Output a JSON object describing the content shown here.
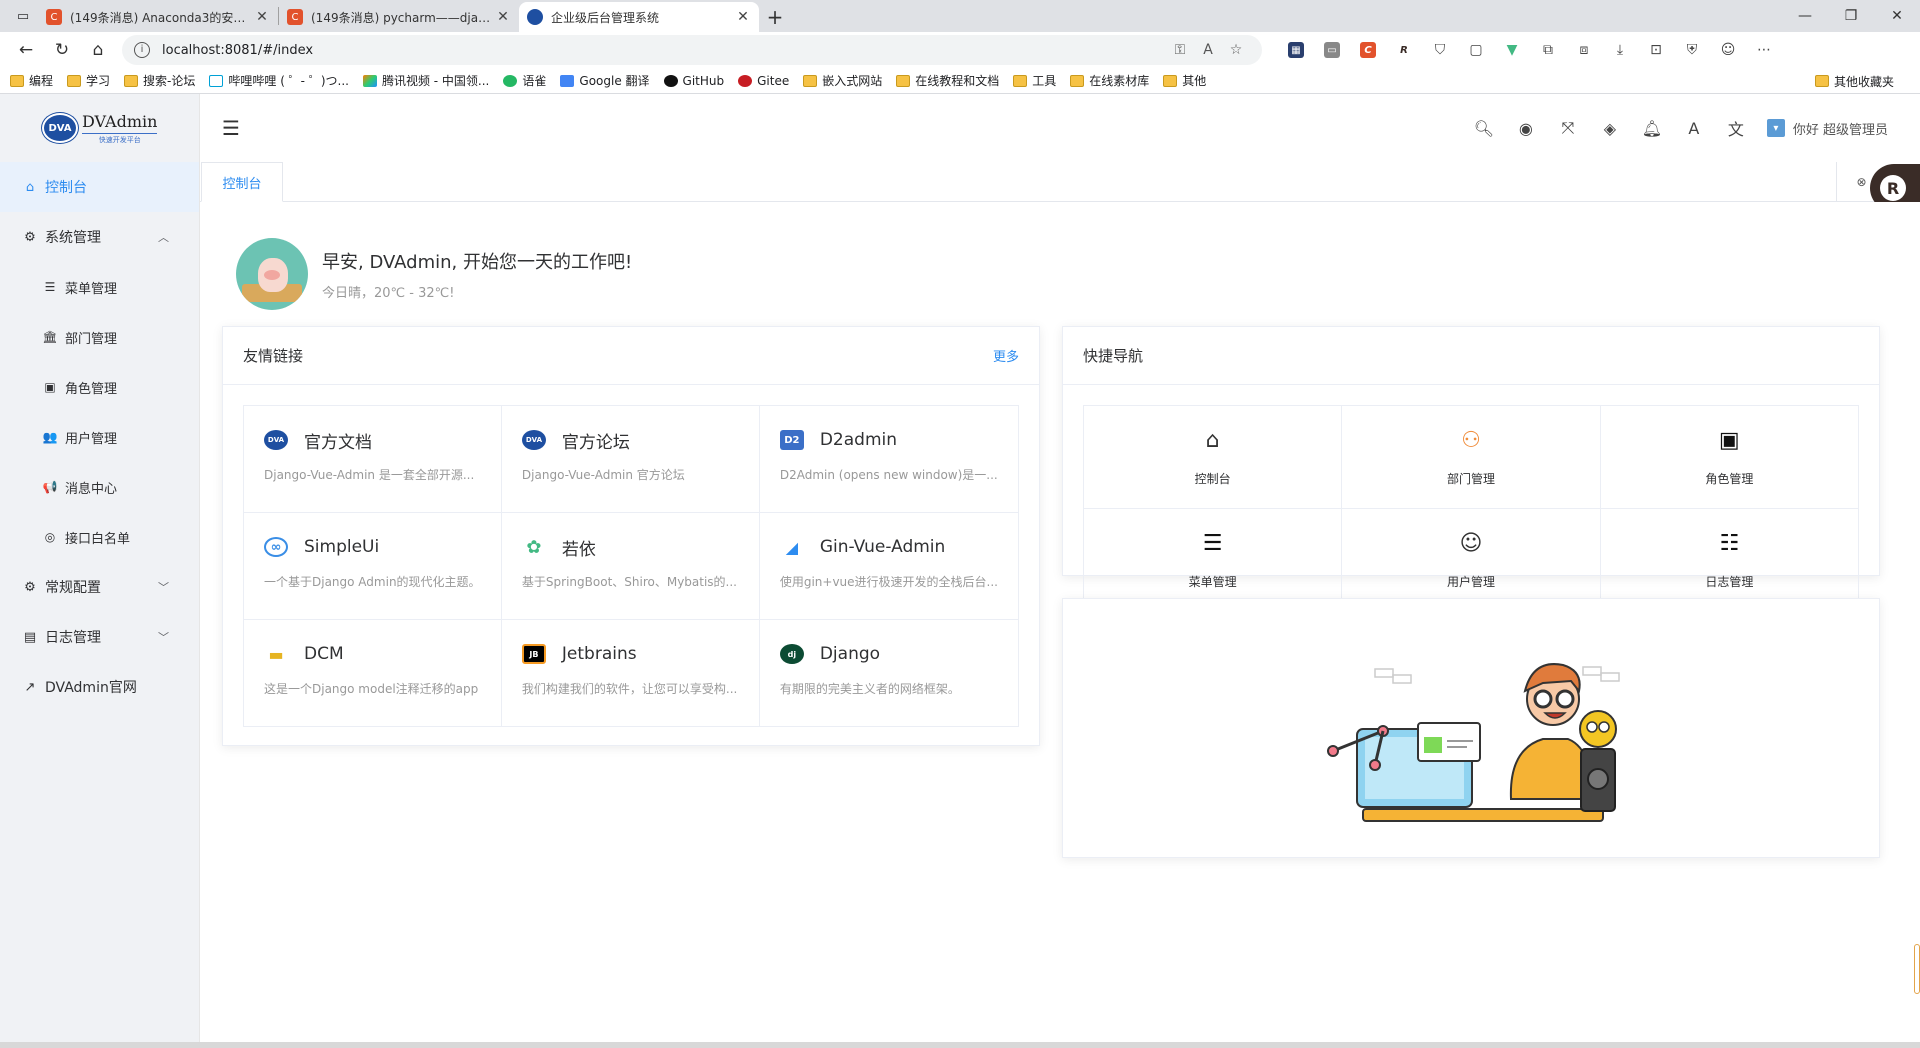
{
  "browser": {
    "tabs": [
      {
        "title": "(149条消息) Anaconda3的安装和",
        "favicon": "C",
        "color": "#e2522c",
        "active": false
      },
      {
        "title": "(149条消息) pycharm——django",
        "favicon": "C",
        "color": "#e2522c",
        "active": false
      },
      {
        "title": "企业级后台管理系统",
        "favicon": "",
        "color": "#1e4fa1",
        "active": true
      }
    ],
    "new_tab": "+",
    "url": "localhost:8081/#/index",
    "bookmarks": [
      "编程",
      "学习",
      "搜索-论坛",
      "哔哩哔哩 ( ゜- ゜)つ...",
      "腾讯视频 - 中国领...",
      "语雀",
      "Google 翻译",
      "GitHub",
      "Gitee",
      "嵌入式网站",
      "在线教程和文档",
      "工具",
      "在线素材库",
      "其他"
    ],
    "other_bookmarks": "其他收藏夹"
  },
  "app": {
    "logo": {
      "name": "DVAdmin",
      "sub": "快速开发平台",
      "badge": "DVA"
    },
    "sidebar": {
      "items": [
        {
          "label": "控制台",
          "icon": "home-icon",
          "glyph": "⌂",
          "active": true
        },
        {
          "label": "系统管理",
          "icon": "gear-icon",
          "glyph": "⚙",
          "arrow": "︿"
        },
        {
          "label": "菜单管理",
          "icon": "menu-icon",
          "glyph": "☰",
          "sub": true
        },
        {
          "label": "部门管理",
          "icon": "building-icon",
          "glyph": "🏛",
          "sub": true
        },
        {
          "label": "角色管理",
          "icon": "id-card-icon",
          "glyph": "▣",
          "sub": true
        },
        {
          "label": "用户管理",
          "icon": "users-icon",
          "glyph": "👥",
          "sub": true
        },
        {
          "label": "消息中心",
          "icon": "bullhorn-icon",
          "glyph": "📢",
          "sub": true
        },
        {
          "label": "接口白名单",
          "icon": "circle-icon",
          "glyph": "◎",
          "sub": true
        },
        {
          "label": "常规配置",
          "icon": "cogs-icon",
          "glyph": "⚙",
          "arrow": "﹀"
        },
        {
          "label": "日志管理",
          "icon": "book-icon",
          "glyph": "▤",
          "arrow": "﹀"
        },
        {
          "label": "DVAdmin官网",
          "icon": "external-link-icon",
          "glyph": "↗"
        }
      ]
    },
    "header": {
      "user": "你好 超级管理员",
      "icons": [
        "search-icon",
        "target-icon",
        "fullscreen-icon",
        "diamond-icon",
        "bell-icon",
        "font-size-icon",
        "language-icon"
      ]
    },
    "tags": {
      "active": "控制台"
    },
    "welcome": {
      "title": "早安, DVAdmin, 开始您一天的工作吧!",
      "weather": "今日晴，20℃ - 32℃!"
    },
    "links_card": {
      "title": "友情链接",
      "more": "更多",
      "items": [
        {
          "name": "官方文档",
          "desc": "Django-Vue-Admin 是一套全部开源...",
          "icon": "dva-icon",
          "color": "#1e4fa1",
          "glyph": "DVA"
        },
        {
          "name": "官方论坛",
          "desc": "Django-Vue-Admin 官方论坛",
          "icon": "dva-icon",
          "color": "#1e4fa1",
          "glyph": "DVA"
        },
        {
          "name": "D2admin",
          "desc": "D2Admin (opens new window)是一...",
          "icon": "d2admin-icon",
          "color": "#3b6fc7",
          "glyph": "D2"
        },
        {
          "name": "SimpleUi",
          "desc": "一个基于Django Admin的现代化主题。",
          "icon": "simpleui-icon",
          "color": "#3a8ee6",
          "glyph": "∞"
        },
        {
          "name": "若依",
          "desc": "基于SpringBoot、Shiro、Mybatis的...",
          "icon": "ruoyi-icon",
          "color": "#42b983",
          "glyph": "✿"
        },
        {
          "name": "Gin-Vue-Admin",
          "desc": "使用gin+vue进行极速开发的全栈后台...",
          "icon": "gva-icon",
          "color": "#2d8cf0",
          "glyph": "◢"
        },
        {
          "name": "DCM",
          "desc": "这是一个Django model注释迁移的app",
          "icon": "dcm-icon",
          "color": "#e6b422",
          "glyph": "▬"
        },
        {
          "name": "Jetbrains",
          "desc": "我们构建我们的软件，让您可以享受构...",
          "icon": "jetbrains-icon",
          "color": "#000000",
          "glyph": "JB"
        },
        {
          "name": "Django",
          "desc": "有期限的完美主义者的网络框架。",
          "icon": "django-icon",
          "color": "#0c4b33",
          "glyph": "dj"
        }
      ]
    },
    "nav_card": {
      "title": "快捷导航",
      "items": [
        {
          "label": "控制台",
          "icon": "home-outline-icon",
          "glyph": "⌂",
          "color": "#333333"
        },
        {
          "label": "部门管理",
          "icon": "org-icon",
          "glyph": "⚇",
          "color": "#f08c3a"
        },
        {
          "label": "角色管理",
          "icon": "id-card-icon",
          "glyph": "▣",
          "color": "#111111"
        },
        {
          "label": "菜单管理",
          "icon": "menu-icon",
          "glyph": "☰",
          "color": "#111111"
        },
        {
          "label": "用户管理",
          "icon": "user-badge-icon",
          "glyph": "☺",
          "color": "#333333"
        },
        {
          "label": "日志管理",
          "icon": "list-icon",
          "glyph": "☷",
          "color": "#111111"
        }
      ]
    }
  }
}
